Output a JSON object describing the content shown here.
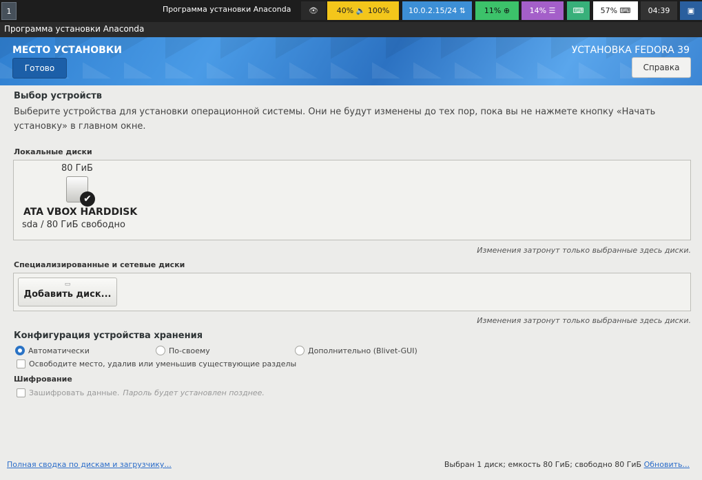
{
  "topbar": {
    "workspace": "1",
    "window_title": "Программа установки Anaconda",
    "blocks": {
      "eye": "👁",
      "volume": "40% 🔈 100%",
      "network": "10.0.2.15/24 ⇅",
      "cpu": "11% ⊕",
      "memory": "14% ☰",
      "keyboard": "⌨",
      "battery": "57% ⌨",
      "time": "04:39",
      "tray": "▣"
    }
  },
  "app_title": "Программа установки Anaconda",
  "header": {
    "title": "МЕСТО УСТАНОВКИ",
    "product": "УСТАНОВКА FEDORA 39",
    "done_label": "Готово",
    "help_label": "Справка"
  },
  "device_selection": {
    "heading": "Выбор устройств",
    "description": "Выберите устройства для установки операционной системы. Они не будут изменены до тех пор, пока вы не нажмете кнопку «Начать установку» в главном окне.",
    "local_heading": "Локальные диски",
    "disk": {
      "size": "80 ГиБ",
      "name": "ATA VBOX HARDDISK",
      "info": "sda  /  80 ГиБ свободно"
    },
    "local_note": "Изменения затронут только выбранные здесь диски.",
    "special_heading": "Специализированные и сетевые диски",
    "add_disk_label": "Добавить диск...",
    "special_note": "Изменения затронут только выбранные здесь диски."
  },
  "storage_config": {
    "heading": "Конфигурация устройства хранения",
    "options": [
      "Автоматически",
      "По-своему",
      "Дополнительно (Blivet-GUI)"
    ],
    "selected": "Автоматически",
    "reclaim_label": "Освободите место, удалив или уменьшив существующие разделы"
  },
  "encryption": {
    "heading": "Шифрование",
    "encrypt_label": "Зашифровать данные.",
    "encrypt_hint": "Пароль будет установлен позднее."
  },
  "footer": {
    "summary_link": "Полная сводка по дискам и загрузчику...",
    "status": "Выбран 1 диск; емкость 80 ГиБ; свободно 80 ГиБ",
    "refresh_link": "Обновить..."
  },
  "colors": {
    "accent": "#2a73c5",
    "done_button": "#1c5fa8",
    "header_blue": "#3c86d4"
  }
}
